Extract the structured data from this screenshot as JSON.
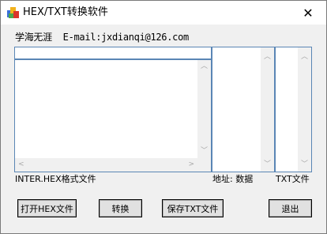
{
  "window": {
    "title": "HEX/TXT转换软件",
    "close_glyph": "✕"
  },
  "author_line": "学海无涯  E-mail:jxdianqi@126.com",
  "panels": {
    "hex_label": "INTER.HEX格式文件",
    "addr_label": "地址: 数据",
    "txt_label": "TXT文件"
  },
  "buttons": {
    "open_hex": "打开HEX文件",
    "convert": "转换",
    "save_txt": "保存TXT文件",
    "exit": "退出"
  },
  "icons": {
    "app": "app-icon",
    "close": "close-icon"
  }
}
